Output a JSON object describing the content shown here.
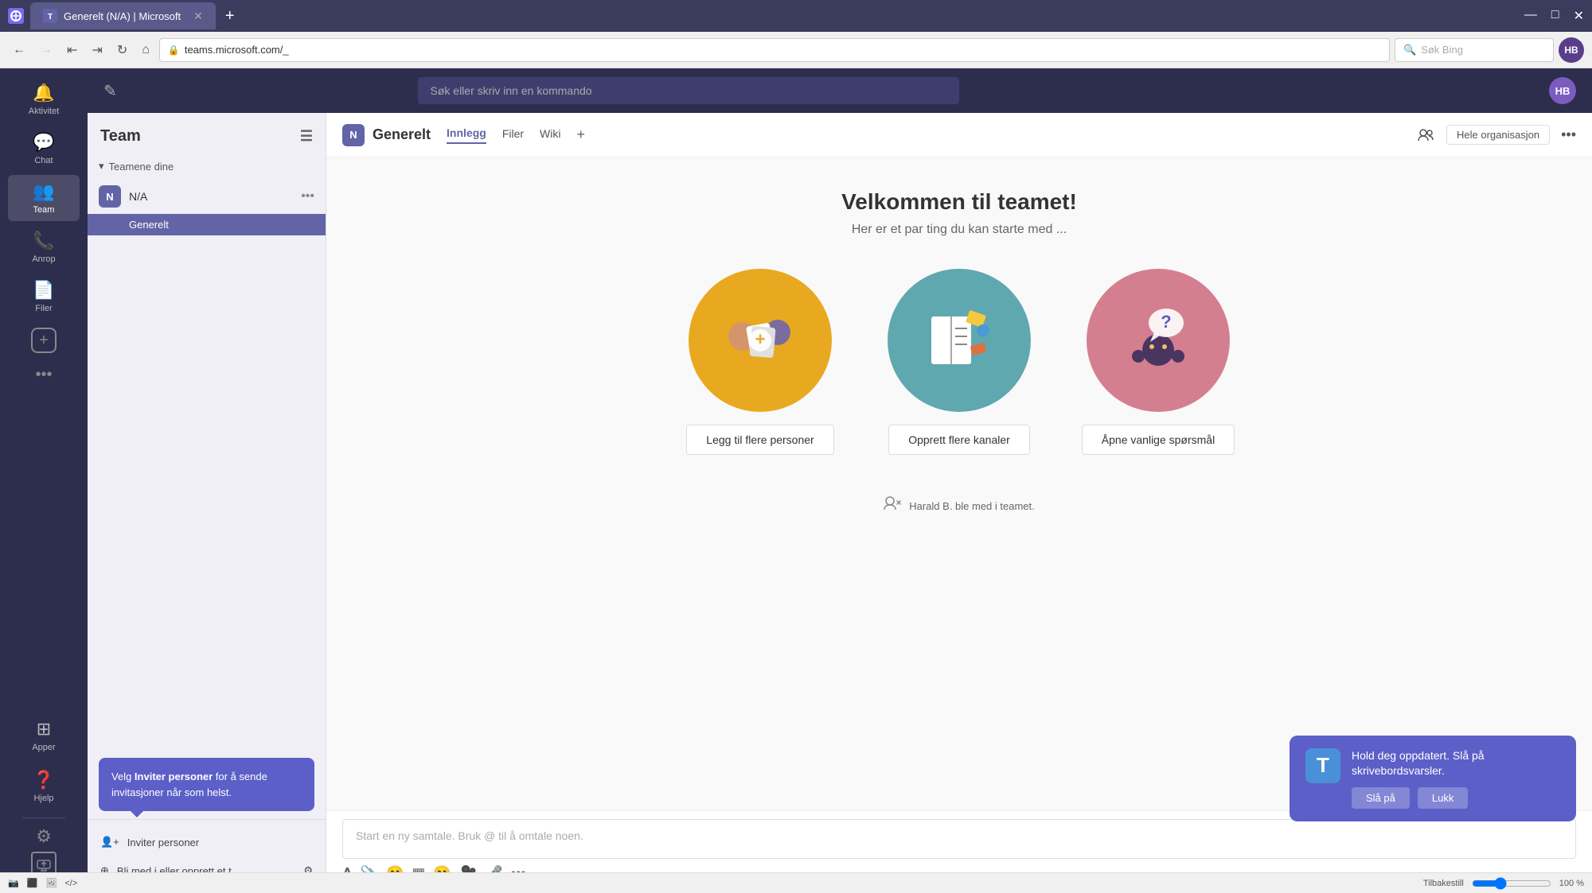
{
  "browser": {
    "tab_title": "Generelt (N/A) | Microsoft",
    "url": "teams.microsoft.com/_",
    "search_placeholder": "Søk Bing",
    "new_tab_label": "+",
    "user_initials": "HB"
  },
  "app_header": {
    "search_placeholder": "Søk eller skriv inn en kommando",
    "user_initials": "HB",
    "edit_icon": "✎"
  },
  "left_rail": {
    "items": [
      {
        "id": "aktivitet",
        "icon": "🔔",
        "label": "Aktivitet"
      },
      {
        "id": "chat",
        "icon": "💬",
        "label": "Chat"
      },
      {
        "id": "team",
        "icon": "👥",
        "label": "Team",
        "active": true
      },
      {
        "id": "anrop",
        "icon": "📞",
        "label": "Anrop"
      },
      {
        "id": "filer",
        "icon": "📄",
        "label": "Filer"
      }
    ],
    "more_label": "•••",
    "apps_label": "Apper",
    "help_label": "Hjelp",
    "settings_icon": "⚙",
    "screen_share_icon": "⬜"
  },
  "teams_panel": {
    "title": "Team",
    "filter_icon": "☰",
    "group_label": "Teamene dine",
    "teams": [
      {
        "name": "N/A",
        "avatar_letter": "N",
        "channels": [
          {
            "name": "Generelt",
            "active": true
          }
        ]
      }
    ],
    "tooltip": {
      "text_before": "Velg ",
      "bold_text": "Inviter personer",
      "text_after": " for å sende invitasjoner når som helst."
    },
    "invite_label": "Inviter personer",
    "join_label": "Bli med i eller opprett et t...",
    "settings_icon": "⚙"
  },
  "channel": {
    "avatar_letter": "N",
    "name": "Generelt",
    "tabs": [
      {
        "id": "innlegg",
        "label": "Innlegg",
        "active": true
      },
      {
        "id": "filer",
        "label": "Filer"
      },
      {
        "id": "wiki",
        "label": "Wiki"
      }
    ],
    "add_tab_icon": "+",
    "org_label": "Hele organisasjon",
    "more_icon": "•••",
    "meet_icon": "👥"
  },
  "welcome": {
    "title": "Velkommen til teamet!",
    "subtitle": "Her er et par ting du kan starte med ...",
    "cards": [
      {
        "id": "add-people",
        "circle_color": "yellow",
        "icon": "➕",
        "button_label": "Legg til flere personer"
      },
      {
        "id": "create-channels",
        "circle_color": "teal",
        "icon": "📋",
        "button_label": "Opprett flere kanaler"
      },
      {
        "id": "faq",
        "circle_color": "pink",
        "icon": "❓",
        "button_label": "Åpne vanlige spørsmål"
      }
    ]
  },
  "join_message": {
    "text": "Harald B. ble med i teamet."
  },
  "message_input": {
    "placeholder": "Start en ny samtale. Bruk @ til å omtale noen."
  },
  "notification": {
    "icon": "T",
    "title": "Hold deg oppdatert. Slå på skrivebordsvarsler.",
    "action_on": "Slå på",
    "action_close": "Lukk"
  },
  "status_bar": {
    "icons": [
      "📷",
      "⬛",
      "🖼",
      "</>"
    ],
    "label": "Tilbakestill",
    "zoom": "100 %"
  }
}
